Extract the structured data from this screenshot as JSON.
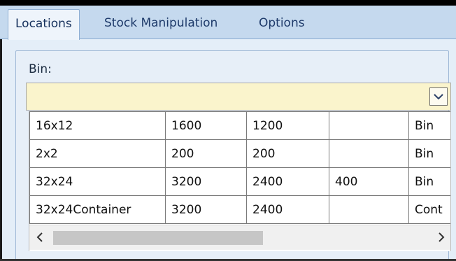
{
  "tabs": [
    {
      "label": "Locations",
      "active": true
    },
    {
      "label": "Stock Manipulation",
      "active": false
    },
    {
      "label": "Options",
      "active": false
    }
  ],
  "bin": {
    "label": "Bin:",
    "value": "",
    "dropdown_icon": "chevron-down-icon"
  },
  "grid": {
    "rows": [
      [
        "16x12",
        "1600",
        "1200",
        "",
        "Bin"
      ],
      [
        "2x2",
        "200",
        "200",
        "",
        "Bin"
      ],
      [
        "32x24",
        "3200",
        "2400",
        "400",
        "Bin"
      ],
      [
        "32x24Container",
        "3200",
        "2400",
        "",
        "Cont"
      ]
    ],
    "scroll_left_icon": "chevron-left-icon",
    "scroll_right_icon": "chevron-right-icon"
  },
  "colors": {
    "tabstrip": "#c5d9ee",
    "panel": "#e4eef8",
    "combo_background": "#faf4cc",
    "tab_text": "#1e3a6a"
  }
}
